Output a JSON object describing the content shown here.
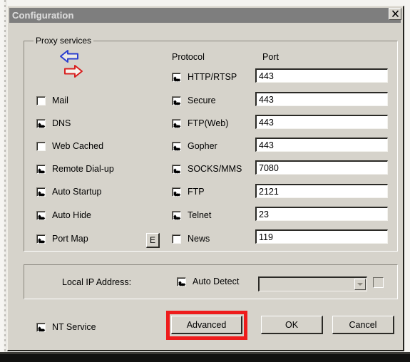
{
  "window": {
    "title": "Configuration",
    "close_label": "✕"
  },
  "proxy_group": {
    "legend": "Proxy services",
    "icon": "exchange-arrows-icon",
    "columns": {
      "protocol_header": "Protocol",
      "port_header": "Port"
    },
    "services": [
      {
        "label": "Mail",
        "checked": false
      },
      {
        "label": "DNS",
        "checked": true
      },
      {
        "label": "Web Cached",
        "checked": false
      },
      {
        "label": "Remote Dial-up",
        "checked": true
      },
      {
        "label": "Auto Startup",
        "checked": true
      },
      {
        "label": "Auto Hide",
        "checked": true
      },
      {
        "label": "Port Map",
        "checked": true
      }
    ],
    "edit_button_label": "E",
    "protocols": [
      {
        "label": "HTTP/RTSP",
        "checked": true,
        "port": "443"
      },
      {
        "label": "Secure",
        "checked": true,
        "port": "443"
      },
      {
        "label": "FTP(Web)",
        "checked": true,
        "port": "443"
      },
      {
        "label": "Gopher",
        "checked": true,
        "port": "443"
      },
      {
        "label": "SOCKS/MMS",
        "checked": true,
        "port": "7080"
      },
      {
        "label": "FTP",
        "checked": true,
        "port": "2121"
      },
      {
        "label": "Telnet",
        "checked": true,
        "port": "23"
      },
      {
        "label": "News",
        "checked": false,
        "port": "119"
      }
    ]
  },
  "ip_group": {
    "label": "Local IP Address:",
    "auto_detect_label": "Auto Detect",
    "auto_detect_checked": true,
    "combo_value": "",
    "extra_checkbox_checked": false
  },
  "footer": {
    "nt_service_label": "NT Service",
    "nt_service_checked": true,
    "advanced_label": "Advanced",
    "ok_label": "OK",
    "cancel_label": "Cancel"
  },
  "colors": {
    "dialog_face": "#d6d3cb",
    "titlebar": "#7e7e7e",
    "highlight_red": "#ee1c1c",
    "arrow_blue": "#2b3fcf",
    "arrow_red": "#d81f1f"
  }
}
